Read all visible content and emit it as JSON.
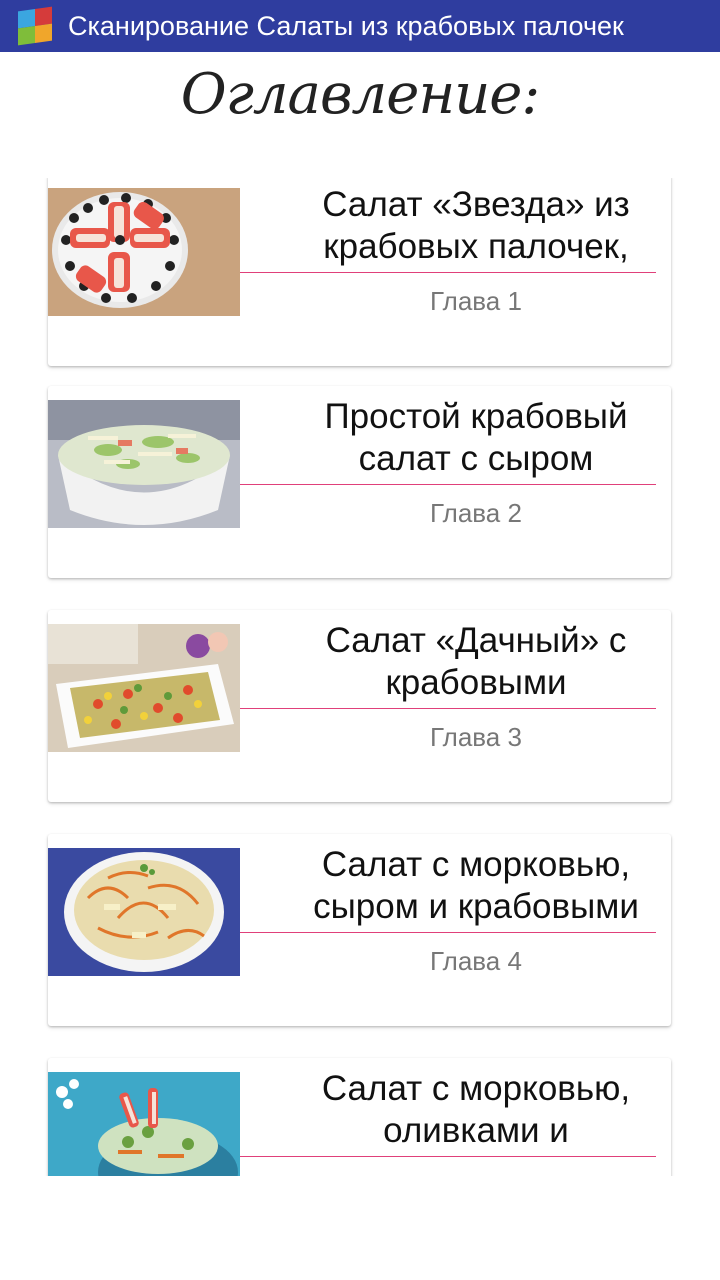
{
  "app": {
    "title": "Сканирование Салаты из крабовых палочек",
    "accent_color": "#2f3d9f",
    "divider_color": "#e0407a"
  },
  "toc": {
    "heading": "Оглавление:"
  },
  "chapters": [
    {
      "title": "Салат «Звезда» из крабовых палочек,",
      "chapter": "Глава 1",
      "image": "star-crab-salad-photo"
    },
    {
      "title": "Простой крабовый салат с сыром",
      "chapter": "Глава 2",
      "image": "crab-cheese-salad-bowl-photo"
    },
    {
      "title": "Салат «Дачный» с крабовыми",
      "chapter": "Глава 3",
      "image": "dacha-salad-platter-photo"
    },
    {
      "title": "Салат с морковью, сыром и крабовыми",
      "chapter": "Глава 4",
      "image": "carrot-cheese-salad-photo"
    },
    {
      "title": "Салат с морковью, оливками и",
      "chapter": "",
      "image": "carrot-olive-salad-photo"
    }
  ]
}
